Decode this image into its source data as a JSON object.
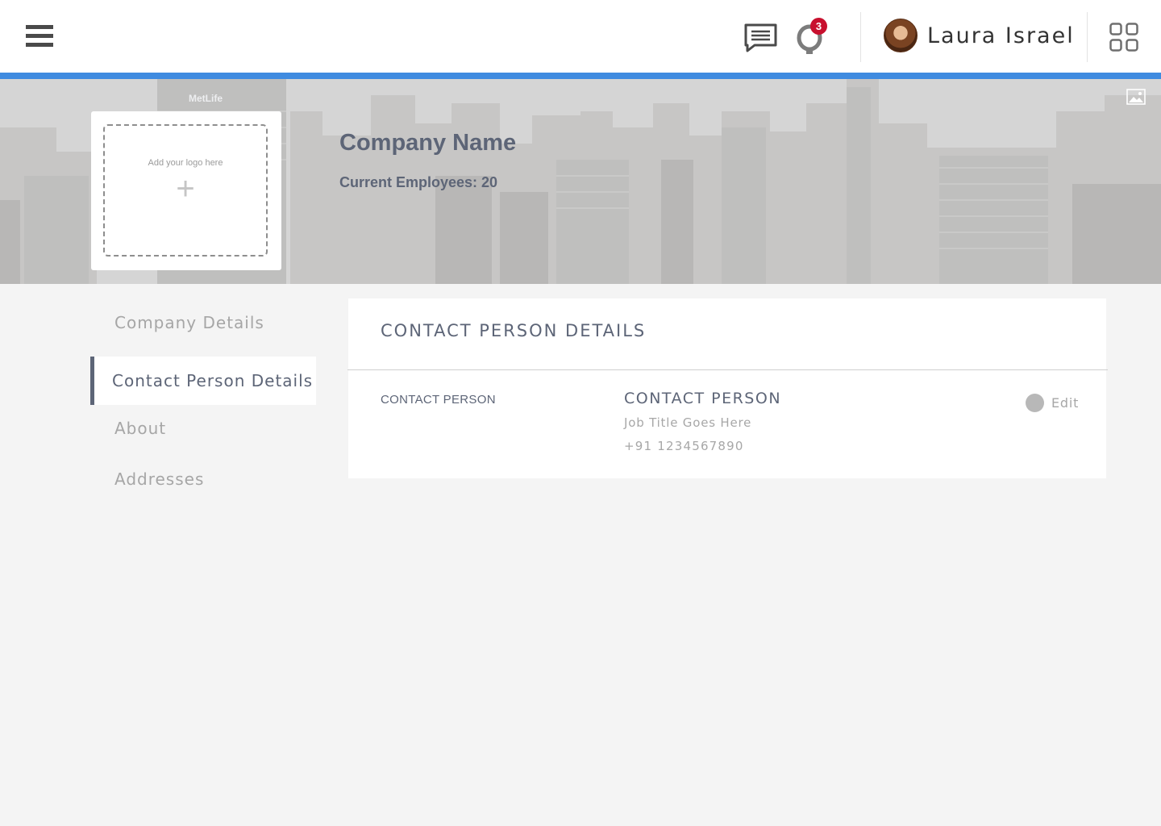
{
  "topbar": {
    "notification_count": "3",
    "user_name": "Laura Israel",
    "icons": [
      "menu-icon",
      "chat-icon",
      "bell-icon",
      "apps-grid-icon"
    ]
  },
  "banner": {
    "logo_hint": "Add your logo here",
    "logo_plus": "+",
    "building_sign": "MetLife",
    "company_name": "Company Name",
    "employees": "Current Employees: 20"
  },
  "sidenav": {
    "items": [
      {
        "label": "Company Details",
        "active": false
      },
      {
        "label": "Contact Person Details",
        "active": true
      },
      {
        "label": "About",
        "active": false
      },
      {
        "label": "Addresses",
        "active": false
      }
    ]
  },
  "card": {
    "title": "CONTACT PERSON DETAILS",
    "field_label": "CONTACT PERSON",
    "contact_name": "CONTACT PERSON",
    "job_title": "Job Title Goes Here",
    "phone": "+91 1234567890",
    "edit_label": "Edit"
  },
  "colors": {
    "accent": "#3f8be0",
    "text_primary": "#5d6577",
    "text_muted": "#a7a7a7",
    "badge": "#c8102e",
    "background": "#f4f4f4"
  }
}
